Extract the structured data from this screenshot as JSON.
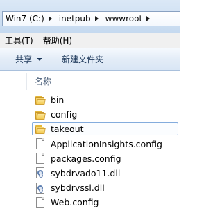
{
  "addressbar": {
    "crumbs": [
      "Win7 (C:)",
      "inetpub",
      "wwwroot"
    ]
  },
  "menubar": {
    "items": [
      "工具(T)",
      "帮助(H)"
    ]
  },
  "commandbar": {
    "share_label": "共享",
    "new_folder_label": "新建文件夹"
  },
  "list": {
    "column_name": "名称",
    "items": [
      {
        "name": "bin",
        "type": "folder"
      },
      {
        "name": "config",
        "type": "folder"
      },
      {
        "name": "takeout",
        "type": "folder",
        "selected": true
      },
      {
        "name": "ApplicationInsights.config",
        "type": "file"
      },
      {
        "name": "packages.config",
        "type": "file"
      },
      {
        "name": "sybdrvado11.dll",
        "type": "dll"
      },
      {
        "name": "sybdrvssl.dll",
        "type": "dll"
      },
      {
        "name": "Web.config",
        "type": "file"
      }
    ]
  }
}
